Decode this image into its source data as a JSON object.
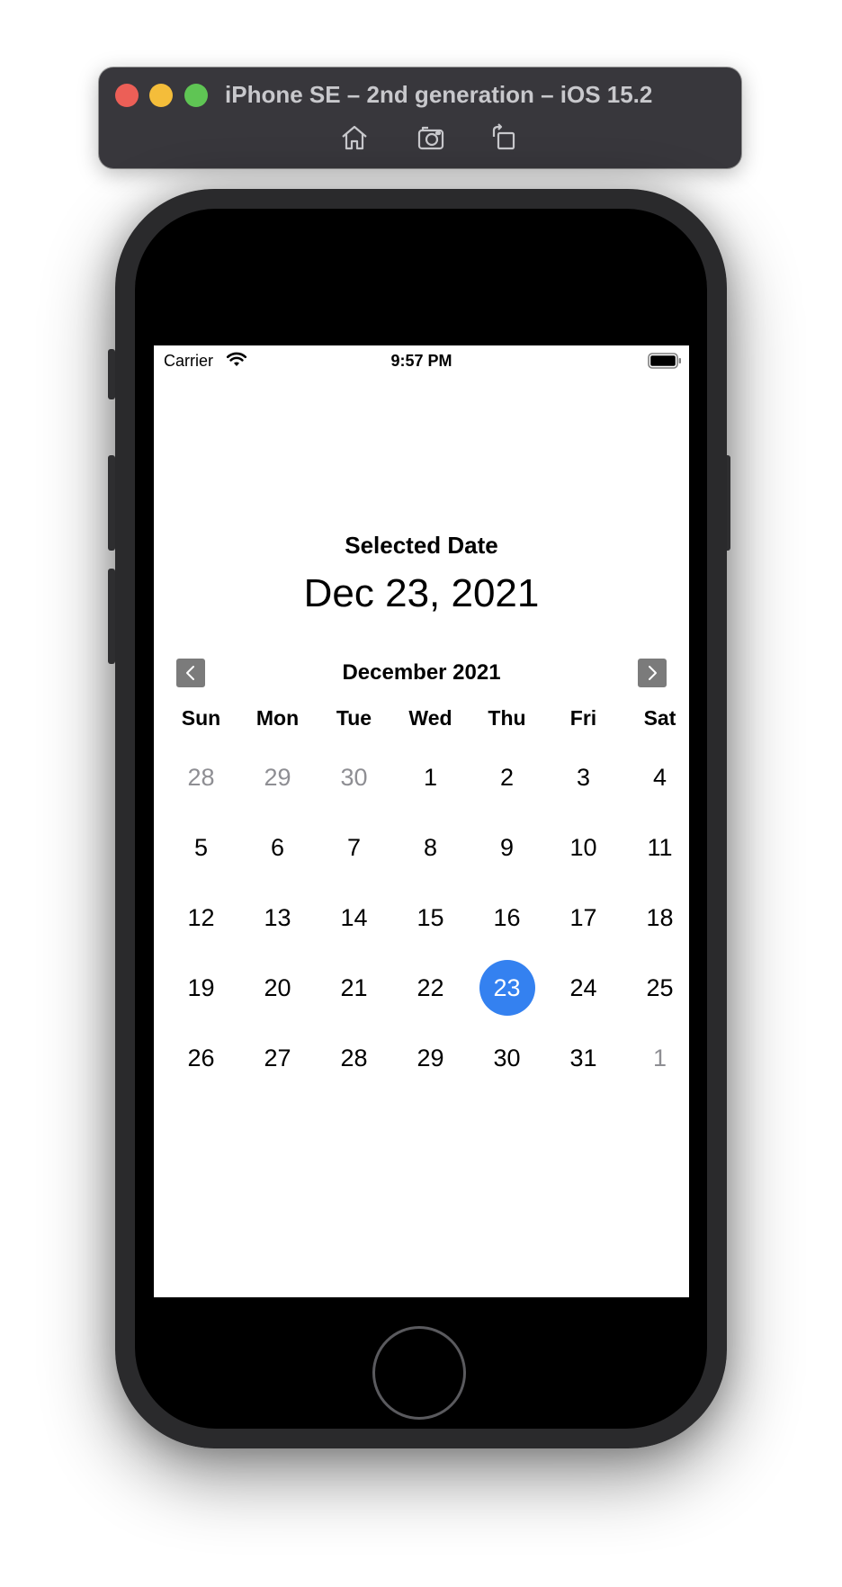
{
  "simulator": {
    "title": "iPhone SE – 2nd generation – iOS 15.2",
    "toolbar": [
      {
        "name": "home",
        "icon": "home-icon"
      },
      {
        "name": "screenshot",
        "icon": "camera-icon"
      },
      {
        "name": "rotate",
        "icon": "rotate-icon"
      }
    ]
  },
  "status_bar": {
    "carrier": "Carrier",
    "time": "9:57 PM"
  },
  "selected": {
    "label": "Selected Date",
    "value": "Dec 23, 2021"
  },
  "calendar": {
    "month_title": "December 2021",
    "weekdays": [
      "Sun",
      "Mon",
      "Tue",
      "Wed",
      "Thu",
      "Fri",
      "Sat"
    ],
    "weeks": [
      [
        {
          "d": "28",
          "muted": true
        },
        {
          "d": "29",
          "muted": true
        },
        {
          "d": "30",
          "muted": true
        },
        {
          "d": "1"
        },
        {
          "d": "2"
        },
        {
          "d": "3"
        },
        {
          "d": "4"
        }
      ],
      [
        {
          "d": "5"
        },
        {
          "d": "6"
        },
        {
          "d": "7"
        },
        {
          "d": "8"
        },
        {
          "d": "9"
        },
        {
          "d": "10"
        },
        {
          "d": "11"
        }
      ],
      [
        {
          "d": "12"
        },
        {
          "d": "13"
        },
        {
          "d": "14"
        },
        {
          "d": "15"
        },
        {
          "d": "16"
        },
        {
          "d": "17"
        },
        {
          "d": "18"
        }
      ],
      [
        {
          "d": "19"
        },
        {
          "d": "20"
        },
        {
          "d": "21"
        },
        {
          "d": "22"
        },
        {
          "d": "23",
          "selected": true
        },
        {
          "d": "24"
        },
        {
          "d": "25"
        }
      ],
      [
        {
          "d": "26"
        },
        {
          "d": "27"
        },
        {
          "d": "28"
        },
        {
          "d": "29"
        },
        {
          "d": "30"
        },
        {
          "d": "31"
        },
        {
          "d": "1",
          "muted": true
        }
      ]
    ],
    "selected_color": "#3481f0",
    "muted_color": "#8e8e93"
  }
}
